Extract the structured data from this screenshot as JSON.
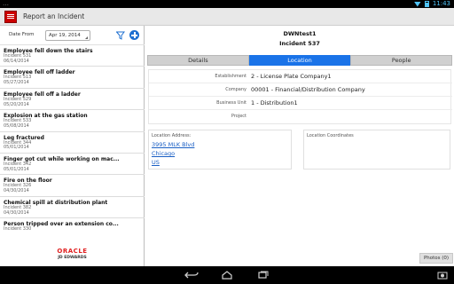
{
  "status_bar": {
    "left_icons": "…",
    "time": "11:43"
  },
  "action_bar": {
    "title": "Report an Incident"
  },
  "left_panel": {
    "date_label": "Date From",
    "date_value": "Apr 19, 2014",
    "incidents": [
      {
        "title": "Employee fell down the stairs",
        "number": "Incident 531",
        "date": "06/14/2014"
      },
      {
        "title": "Employee fell off ladder",
        "number": "Incident 513",
        "date": "05/27/2014"
      },
      {
        "title": "Employee fell off a ladder",
        "number": "Incident 529",
        "date": "05/20/2014"
      },
      {
        "title": "Explosion at the gas station",
        "number": "Incident 533",
        "date": "05/08/2014"
      },
      {
        "title": "Leg fractured",
        "number": "Incident 344",
        "date": "05/01/2014"
      },
      {
        "title": "Finger got cut while working on mac...",
        "number": "Incident 342",
        "date": "05/01/2014"
      },
      {
        "title": "Fire on the floor",
        "number": "Incident 326",
        "date": "04/30/2014"
      },
      {
        "title": "Chemical spill at distribution plant",
        "number": "Incident 382",
        "date": "04/30/2014"
      },
      {
        "title": "Person tripped over an extension co...",
        "number": "Incident 330",
        "date": ""
      }
    ],
    "logo_top": "ORACLE",
    "logo_bottom": "JD EDWARDS"
  },
  "detail": {
    "name": "DWNtest1",
    "incident": "Incident 537",
    "tabs": [
      {
        "label": "Details",
        "active": false
      },
      {
        "label": "Location",
        "active": true
      },
      {
        "label": "People",
        "active": false
      }
    ],
    "fields": [
      {
        "label": "Establishment",
        "value": "2 - License Plate Company1"
      },
      {
        "label": "Company",
        "value": "00001 - Financial/Distribution Company"
      },
      {
        "label": "Business Unit",
        "value": "1 - Distribution1"
      },
      {
        "label": "Project",
        "value": ""
      }
    ],
    "address_label": "Location Address:",
    "address_lines": [
      "3995 MLK Blvd",
      "Chicago",
      "US"
    ],
    "coords_label": "Location Coordinates",
    "photos_button": "Photos (0)"
  },
  "colors": {
    "accent": "#1a73e8",
    "oracle_red": "#e02020",
    "status_bar": "#000000"
  },
  "icons": [
    "app-icon",
    "filter-icon",
    "add-icon",
    "back-icon",
    "home-icon",
    "recent-apps-icon",
    "screenshot-icon",
    "wifi-icon",
    "battery-icon"
  ]
}
